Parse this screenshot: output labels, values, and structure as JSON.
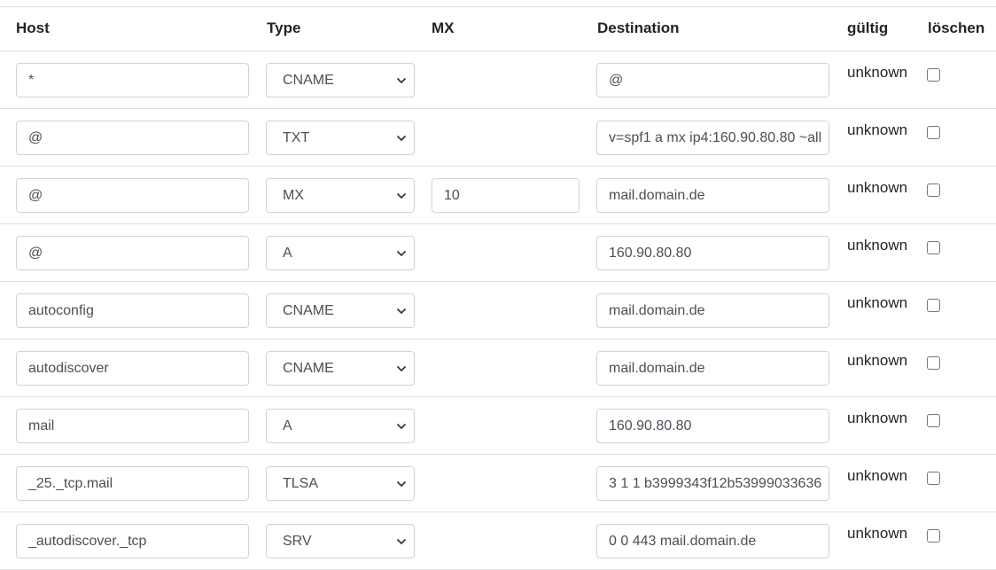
{
  "table": {
    "headers": {
      "host": "Host",
      "type": "Type",
      "mx": "MX",
      "destination": "Destination",
      "valid": "gültig",
      "delete": "löschen"
    },
    "rows": [
      {
        "host": "*",
        "type": "CNAME",
        "mx": null,
        "destination": "@",
        "status": "unknown",
        "delete_checked": false
      },
      {
        "host": "@",
        "type": "TXT",
        "mx": null,
        "destination": "v=spf1 a mx ip4:160.90.80.80 ~all",
        "status": "unknown",
        "delete_checked": false
      },
      {
        "host": "@",
        "type": "MX",
        "mx": "10",
        "destination": "mail.domain.de",
        "status": "unknown",
        "delete_checked": false
      },
      {
        "host": "@",
        "type": "A",
        "mx": null,
        "destination": "160.90.80.80",
        "status": "unknown",
        "delete_checked": false
      },
      {
        "host": "autoconfig",
        "type": "CNAME",
        "mx": null,
        "destination": "mail.domain.de",
        "status": "unknown",
        "delete_checked": false
      },
      {
        "host": "autodiscover",
        "type": "CNAME",
        "mx": null,
        "destination": "mail.domain.de",
        "status": "unknown",
        "delete_checked": false
      },
      {
        "host": "mail",
        "type": "A",
        "mx": null,
        "destination": "160.90.80.80",
        "status": "unknown",
        "delete_checked": false
      },
      {
        "host": "_25._tcp.mail",
        "type": "TLSA",
        "mx": null,
        "destination": "3 1 1 b3999343f12b53999033636",
        "status": "unknown",
        "delete_checked": false
      },
      {
        "host": "_autodiscover._tcp",
        "type": "SRV",
        "mx": null,
        "destination": "0 0 443 mail.domain.de",
        "status": "unknown",
        "delete_checked": false
      }
    ]
  }
}
